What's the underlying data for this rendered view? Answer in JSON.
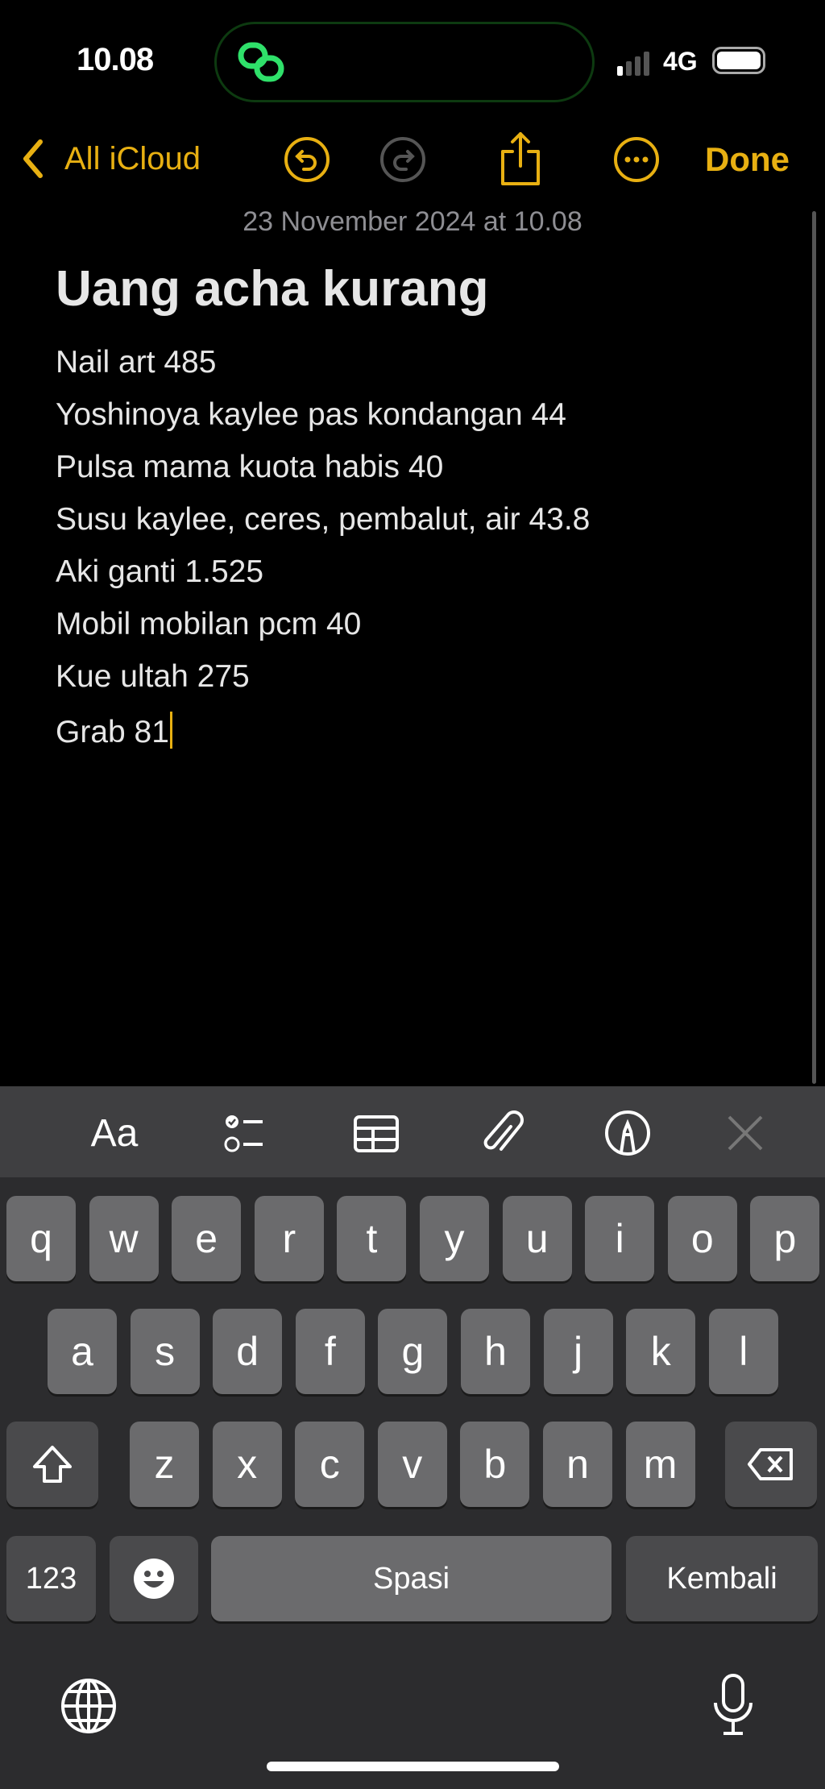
{
  "status": {
    "time": "10.08",
    "network": "4G"
  },
  "nav": {
    "back_label": "All iCloud",
    "done_label": "Done"
  },
  "note": {
    "date": "23 November 2024 at 10.08",
    "title": "Uang acha kurang",
    "lines": [
      "Nail art 485",
      "Yoshinoya kaylee pas kondangan 44",
      "Pulsa mama kuota habis 40",
      "Susu kaylee, ceres, pembalut, air 43.8",
      "Aki ganti 1.525",
      "Mobil mobilan pcm 40",
      "Kue ultah 275",
      "Grab 81"
    ]
  },
  "toolbar": {
    "format_label": "Aa"
  },
  "keyboard": {
    "row1": [
      "q",
      "w",
      "e",
      "r",
      "t",
      "y",
      "u",
      "i",
      "o",
      "p"
    ],
    "row2": [
      "a",
      "s",
      "d",
      "f",
      "g",
      "h",
      "j",
      "k",
      "l"
    ],
    "row3": [
      "z",
      "x",
      "c",
      "v",
      "b",
      "n",
      "m"
    ],
    "numbers_label": "123",
    "space_label": "Spasi",
    "return_label": "Kembali"
  },
  "colors": {
    "accent": "#e8b012",
    "background": "#000000",
    "keyboard": "#2c2c2e"
  }
}
